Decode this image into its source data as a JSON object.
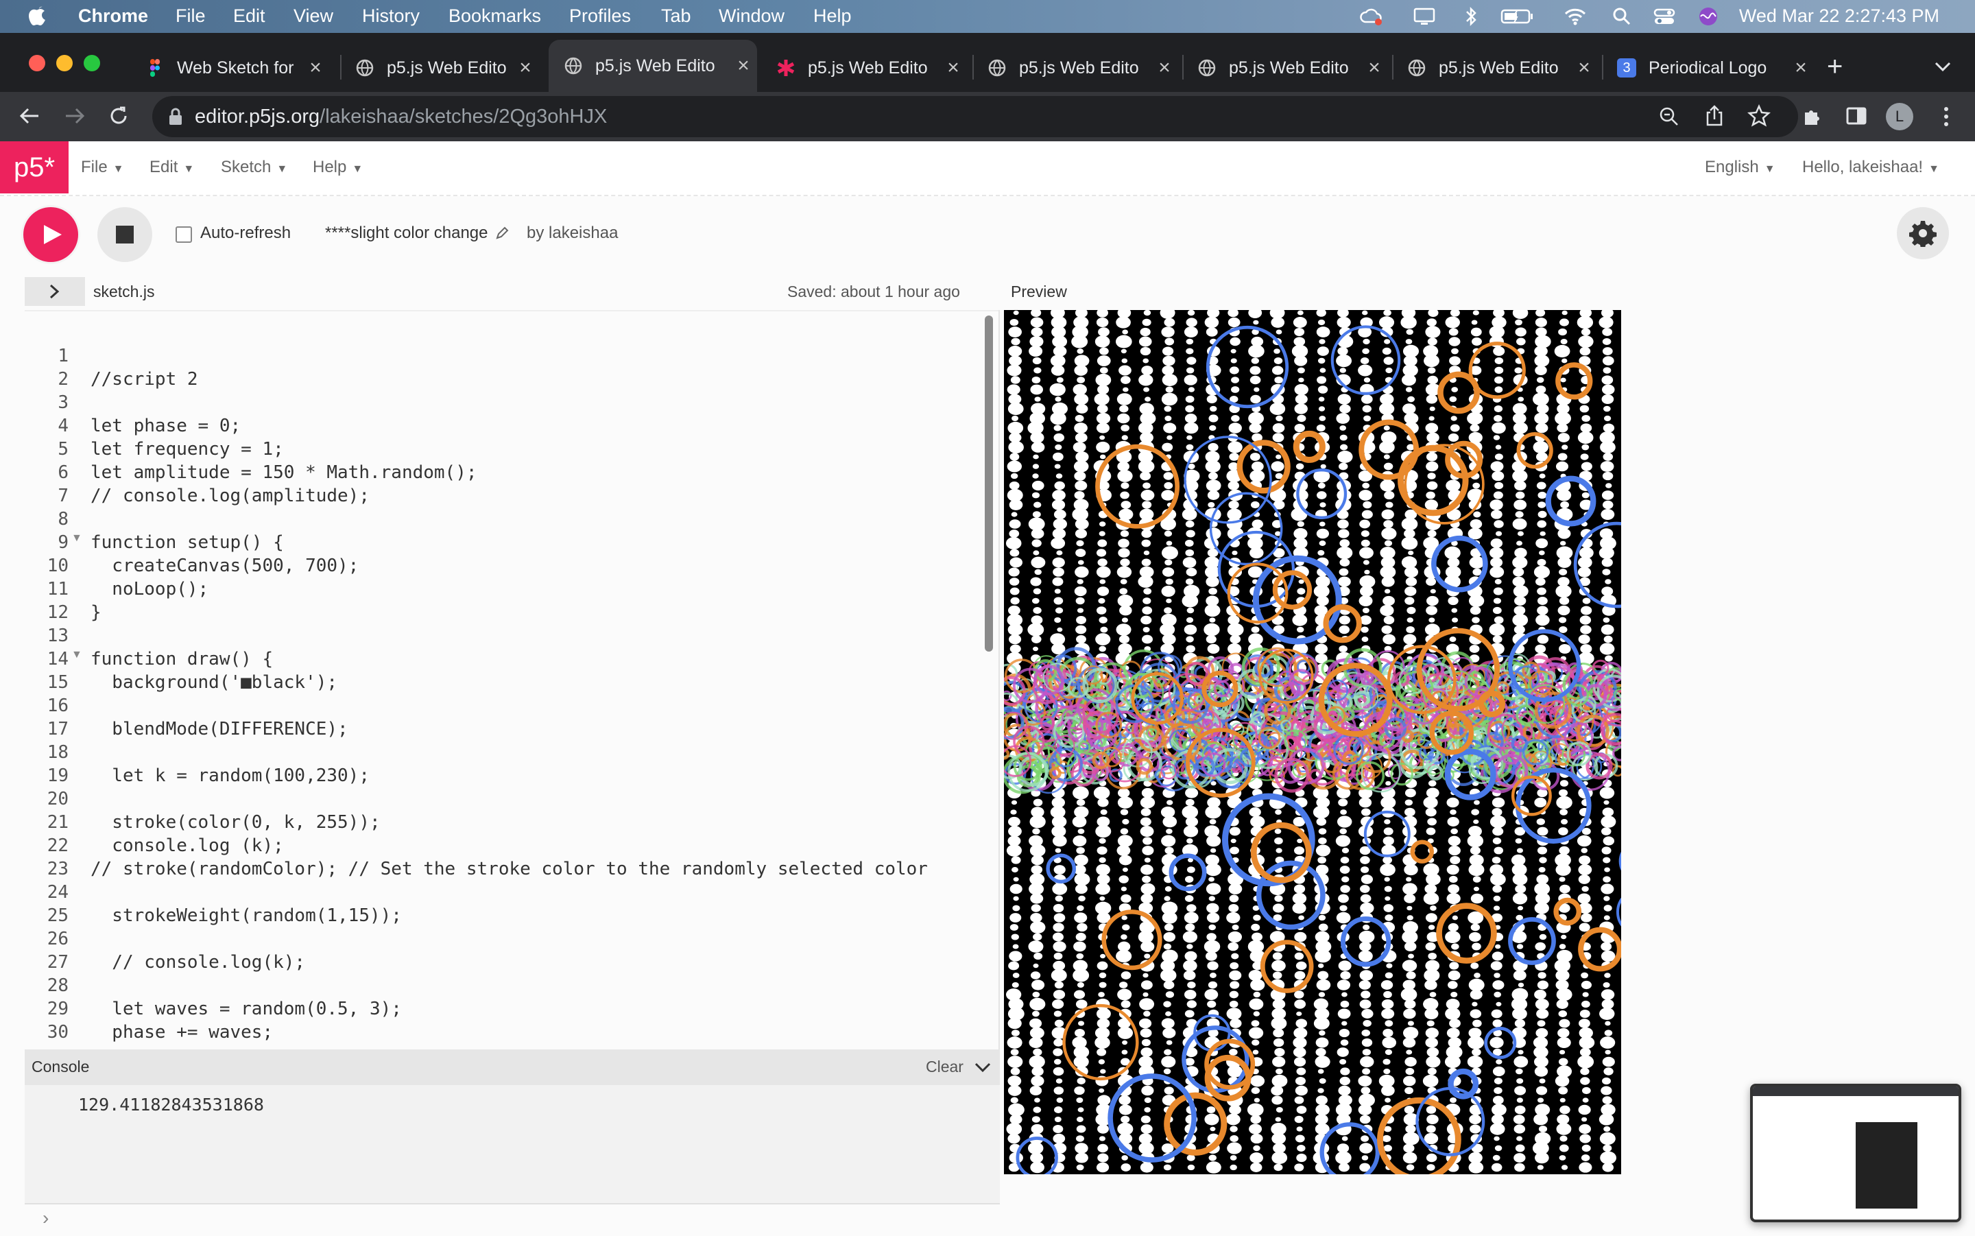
{
  "menubar": {
    "app_name": "Chrome",
    "items": [
      "File",
      "Edit",
      "View",
      "History",
      "Bookmarks",
      "Profiles",
      "Tab",
      "Window",
      "Help"
    ],
    "clock": "Wed Mar 22  2:27:43 PM"
  },
  "tabs": [
    {
      "title": "Web Sketch for",
      "icon": "figma-icon"
    },
    {
      "title": "p5.js Web Edito",
      "icon": "globe-icon"
    },
    {
      "title": "p5.js Web Edito",
      "icon": "globe-icon",
      "active": true
    },
    {
      "title": "p5.js Web Edito",
      "icon": "asterisk-icon"
    },
    {
      "title": "p5.js Web Edito",
      "icon": "globe-icon"
    },
    {
      "title": "p5.js Web Edito",
      "icon": "globe-icon"
    },
    {
      "title": "p5.js Web Edito",
      "icon": "globe-icon"
    },
    {
      "title": "Periodical Logo",
      "icon": "numbered-doc-icon",
      "badge": "3"
    }
  ],
  "address": {
    "host": "editor.p5js.org",
    "path": "/lakeishaa/sketches/2Qg3ohHJX"
  },
  "profile_initial": "L",
  "p5": {
    "logo": "p5*",
    "nav": {
      "file": "File",
      "edit": "Edit",
      "sketch": "Sketch",
      "help": "Help",
      "language": "English",
      "greeting": "Hello, lakeishaa!"
    },
    "auto_refresh": "Auto-refresh",
    "sketch_name": "****slight color change",
    "author": "by lakeishaa",
    "file_name": "sketch.js",
    "saved": "Saved: about 1 hour ago",
    "preview_label": "Preview"
  },
  "code": {
    "line_numbers": [
      "1",
      "2",
      "3",
      "4",
      "5",
      "6",
      "7",
      "8",
      "9",
      "10",
      "11",
      "12",
      "13",
      "14",
      "15",
      "16",
      "17",
      "18",
      "19",
      "20",
      "21",
      "22",
      "23",
      "24",
      "25",
      "26",
      "27",
      "28",
      "29",
      "30"
    ],
    "lines": [
      "",
      "//script 2",
      "",
      "let phase = 0;",
      "let frequency = 1;",
      "let amplitude = 150 * Math.random();",
      "// console.log(amplitude);",
      "",
      "function setup() {",
      "  createCanvas(500, 700);",
      "  noLoop();",
      "}",
      "",
      "function draw() {",
      "  background('■black');",
      "",
      "  blendMode(DIFFERENCE);",
      "",
      "  let k = random(100,230);",
      "",
      "  stroke(color(0, k, 255));",
      "  console.log (k);",
      "// stroke(randomColor); // Set the stroke color to the randomly selected color",
      "",
      "  strokeWeight(random(1,15));",
      "",
      "  // console.log(k);",
      "",
      "  let waves = random(0.5, 3);",
      "  phase += waves;"
    ]
  },
  "console": {
    "label": "Console",
    "clear": "Clear",
    "output": "129.41182843531868",
    "prompt": "›"
  },
  "colors": {
    "p5_pink": "#ed225d",
    "accent_blue": "#4a7ae8",
    "accent_orange": "#e8892d"
  }
}
